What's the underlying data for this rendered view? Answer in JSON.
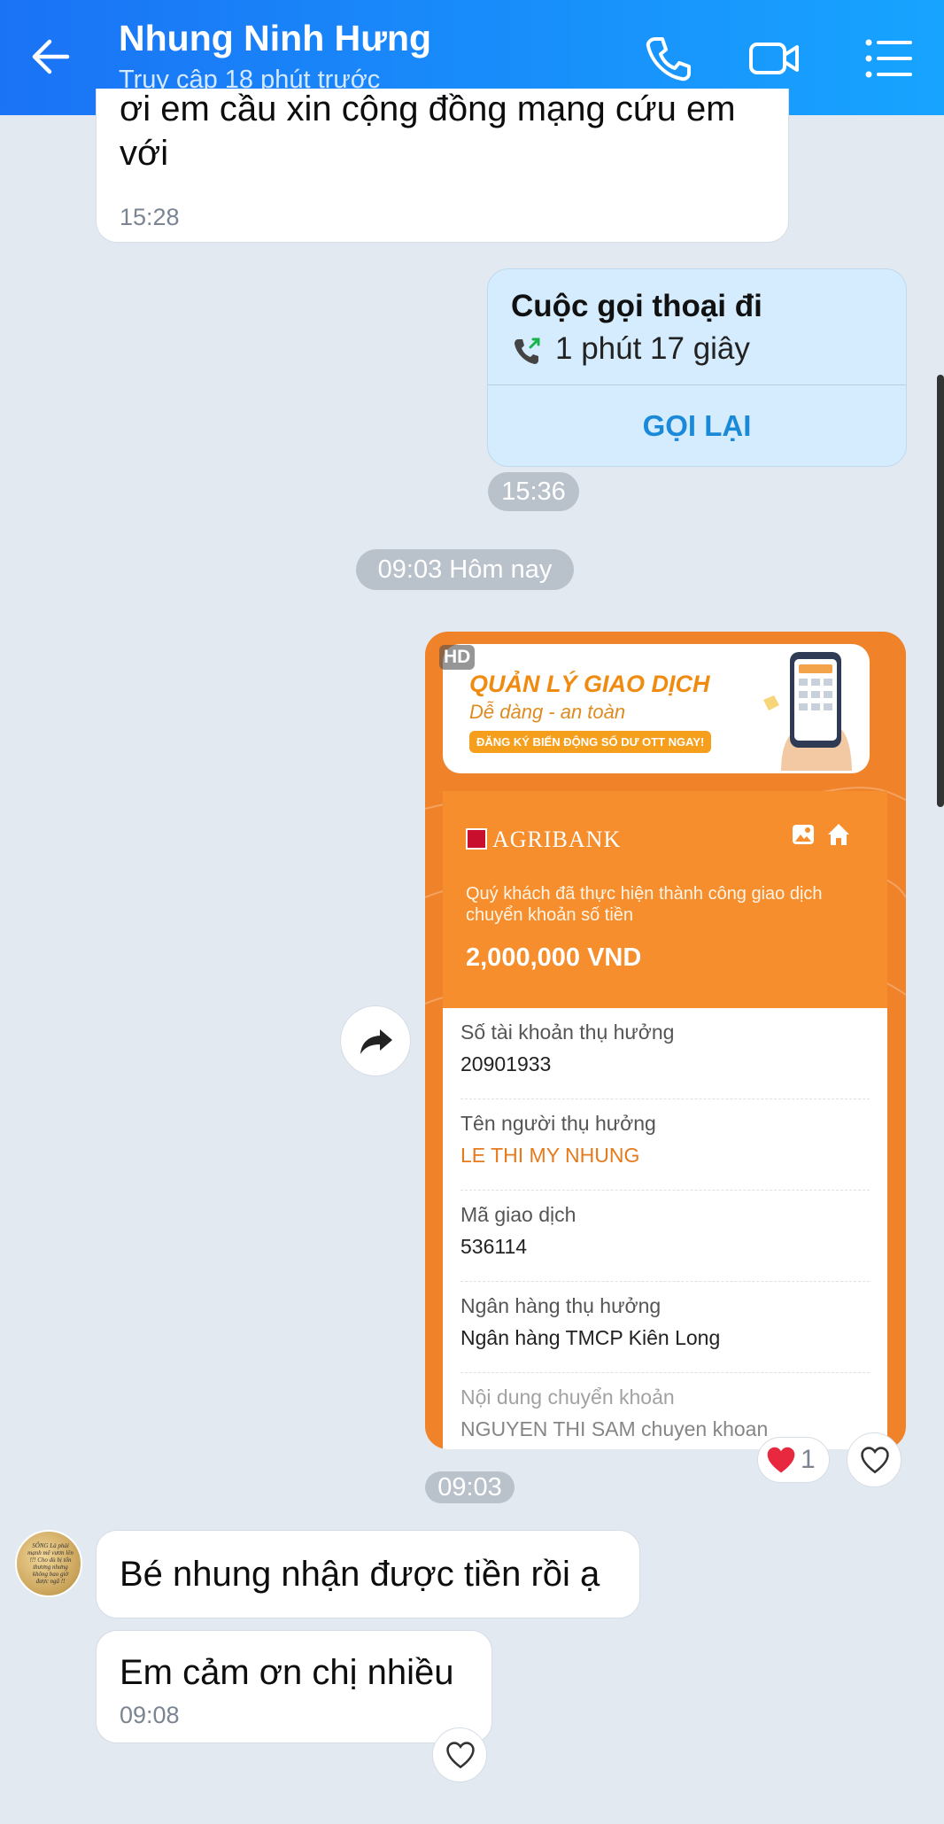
{
  "header": {
    "title": "Nhung Ninh Hưng",
    "subtitle": "Truy cập 18 phút trước",
    "icons": [
      "back-arrow-icon",
      "phone-icon",
      "video-camera-icon",
      "menu-list-icon"
    ]
  },
  "messages": {
    "first": {
      "text": "ơi em cầu xin cộng đồng mạng cứu em với",
      "time": "15:28"
    },
    "call": {
      "title": "Cuộc gọi thoại đi",
      "duration": "1 phút 17 giây",
      "action": "GỌI LẠI",
      "time": "15:36"
    },
    "day_separator": "09:03 Hôm nay",
    "receipt_time": "09:03",
    "reply1": {
      "text": "Bé nhung nhận được tiền rồi ạ"
    },
    "reply2": {
      "text": "Em cảm ơn chị nhiều",
      "time": "09:08"
    }
  },
  "receipt": {
    "hd_badge": "HD",
    "banner_title": "QUẢN LÝ GIAO DỊCH",
    "banner_sub": "Dễ dàng - an toàn",
    "banner_cta": "ĐĂNG KÝ BIẾN ĐỘNG SỐ DƯ OTT NGAY!",
    "bank_name": "AGRIBANK",
    "notice": "Quý khách đã thực hiện thành công giao dịch chuyển khoản số tiền",
    "amount": "2,000,000 VND",
    "fields": [
      {
        "label": "Số tài khoản thụ hưởng",
        "value": "20901933"
      },
      {
        "label": "Tên người thụ hưởng",
        "value": "LE THI MY NHUNG"
      },
      {
        "label": "Mã giao dịch",
        "value": "536114"
      },
      {
        "label": "Ngân hàng thụ hưởng",
        "value": "Ngân hàng TMCP Kiên Long"
      },
      {
        "label": "Nội dung chuyển khoản",
        "value": "NGUYEN THI SAM chuyen khoan"
      }
    ]
  },
  "reactions": {
    "heart_count": "1"
  },
  "avatar_text": "SỐNG Là phải mạnh mẽ vươn lên !!! Cho dù bị tổn thương nhưng không bao giờ được ngã !!",
  "colors": {
    "header_start": "#1a73f5",
    "header_end": "#17a4ff",
    "chat_bg": "#e2e9f1",
    "call_bg": "#d4ecfd",
    "accent_blue": "#1a8ad8",
    "receipt_orange": "#f68e2d"
  }
}
